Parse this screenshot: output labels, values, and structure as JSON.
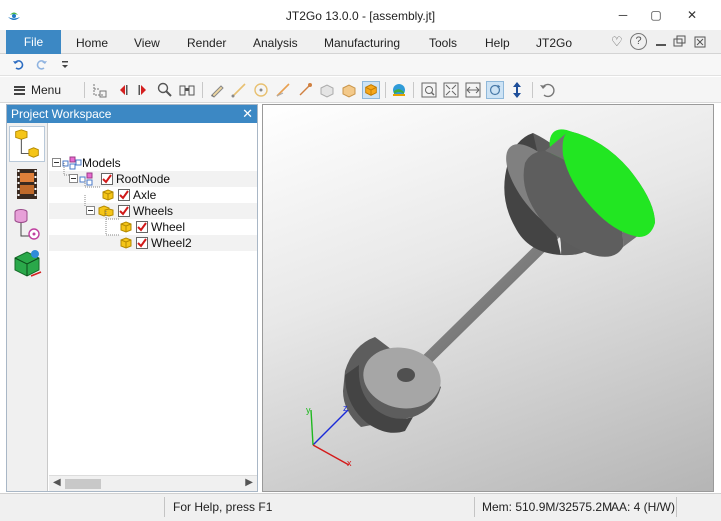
{
  "window": {
    "title": "JT2Go 13.0.0 - [assembly.jt]",
    "minimize_glyph": "─",
    "maximize_glyph": "▢",
    "close_glyph": "✕"
  },
  "menubar": {
    "file_label": "File",
    "items": [
      "Home",
      "View",
      "Render",
      "Analysis",
      "Manufacturing",
      "Tools",
      "Help",
      "JT2Go"
    ],
    "ribbon_toggle_glyph": "♡",
    "help_glyph": "?"
  },
  "toolbar": {
    "menu_label": "Menu"
  },
  "workspace": {
    "title": "Project Workspace",
    "close_glyph": "✕",
    "tree": [
      {
        "label": "Models",
        "level": 0
      },
      {
        "label": "RootNode",
        "level": 1
      },
      {
        "label": "Axle",
        "level": 2
      },
      {
        "label": "Wheels",
        "level": 2
      },
      {
        "label": "Wheel",
        "level": 3
      },
      {
        "label": "Wheel2",
        "level": 3
      }
    ]
  },
  "viewport": {
    "axis_x": "x",
    "axis_y": "y",
    "axis_z": "z",
    "colors": {
      "highlight": "#22e622",
      "part": "#8a8a8a"
    }
  },
  "statusbar": {
    "help_text": "For Help, press F1",
    "memory": "Mem: 510.9M/32575.2M",
    "aa": "AA: 4 (H/W)"
  }
}
